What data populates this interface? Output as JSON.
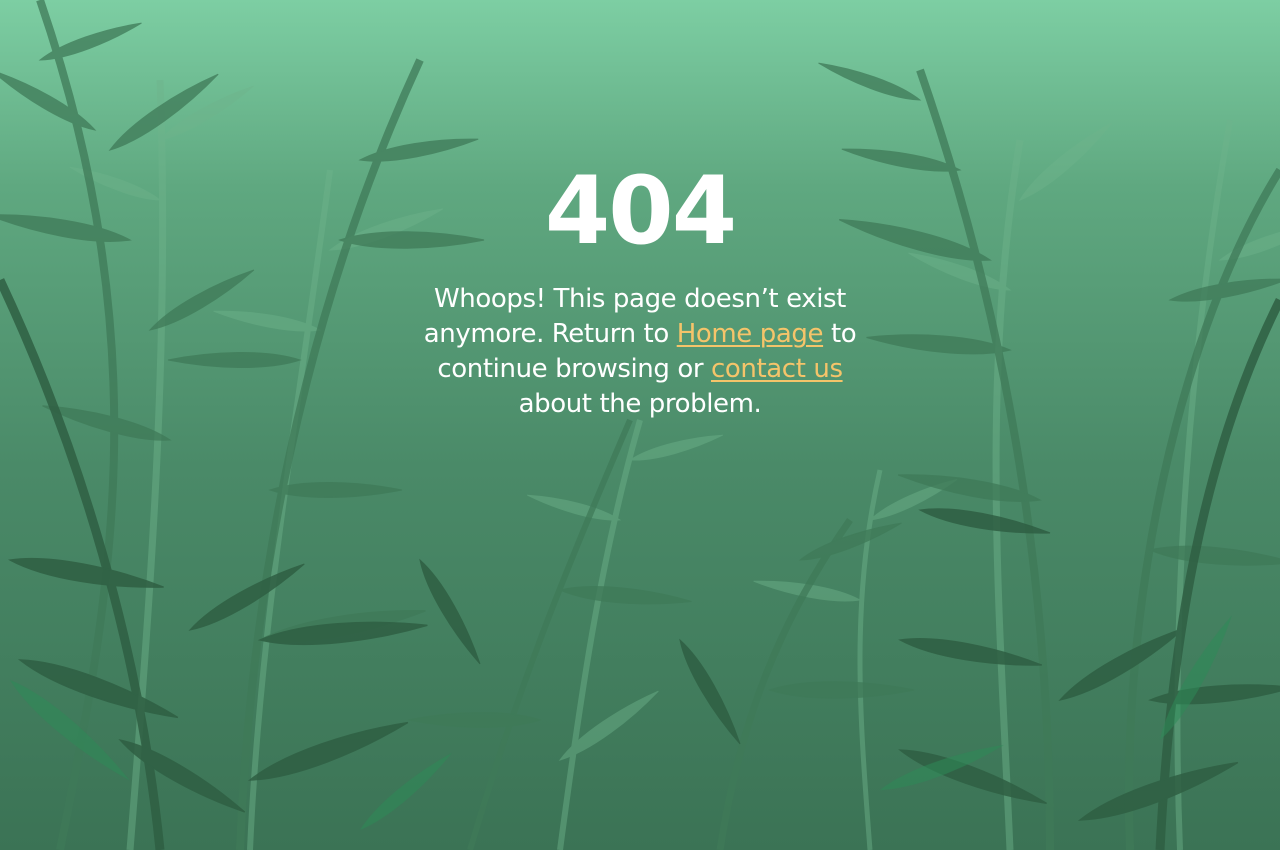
{
  "error": {
    "code": "404",
    "text_before_home": "Whoops! This page doesn’t exist anymore. Return to ",
    "home_link": "Home page",
    "text_between": " to continue browsing or ",
    "contact_link": "contact us",
    "text_after": " about the problem."
  },
  "colors": {
    "sky_top": "#7dcea3",
    "sky_bottom": "#3b7355",
    "link": "#f5c46a",
    "text": "#ffffff"
  },
  "background": {
    "illustration": "bamboo-forest"
  }
}
